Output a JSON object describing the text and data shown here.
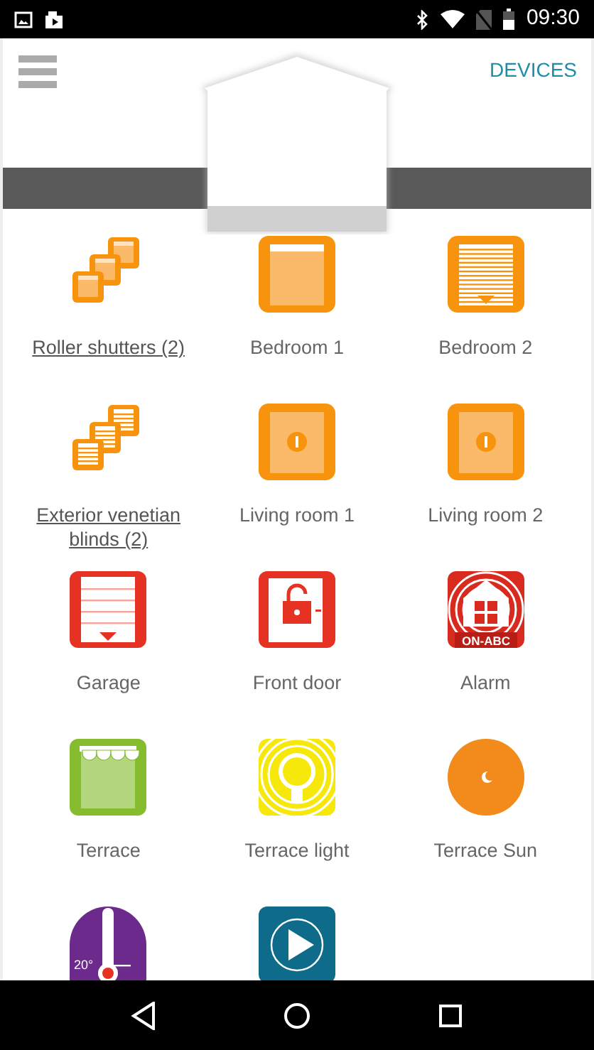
{
  "status_bar": {
    "time": "09:30"
  },
  "header": {
    "action": "DEVICES"
  },
  "tiles": [
    {
      "kind": "shutters-group",
      "label": "Roller shutters (2)",
      "group": true
    },
    {
      "kind": "shutter-open",
      "label": "Bedroom 1",
      "group": false
    },
    {
      "kind": "shutter-closed",
      "label": "Bedroom 2",
      "group": false
    },
    {
      "kind": "blinds-group",
      "label": "Exterior venetian blinds (2)",
      "group": true
    },
    {
      "kind": "lock",
      "label": "Living room 1",
      "group": false
    },
    {
      "kind": "lock",
      "label": "Living room 2",
      "group": false
    },
    {
      "kind": "garage",
      "label": "Garage",
      "group": false
    },
    {
      "kind": "front-door",
      "label": "Front door",
      "group": false
    },
    {
      "kind": "alarm",
      "label": "Alarm",
      "icon_text": "ON-ABC",
      "group": false
    },
    {
      "kind": "awning",
      "label": "Terrace",
      "group": false
    },
    {
      "kind": "light",
      "label": "Terrace light",
      "group": false
    },
    {
      "kind": "sun",
      "label": "Terrace Sun",
      "group": false
    },
    {
      "kind": "thermostat",
      "icon_text": "20°"
    },
    {
      "kind": "play"
    }
  ]
}
